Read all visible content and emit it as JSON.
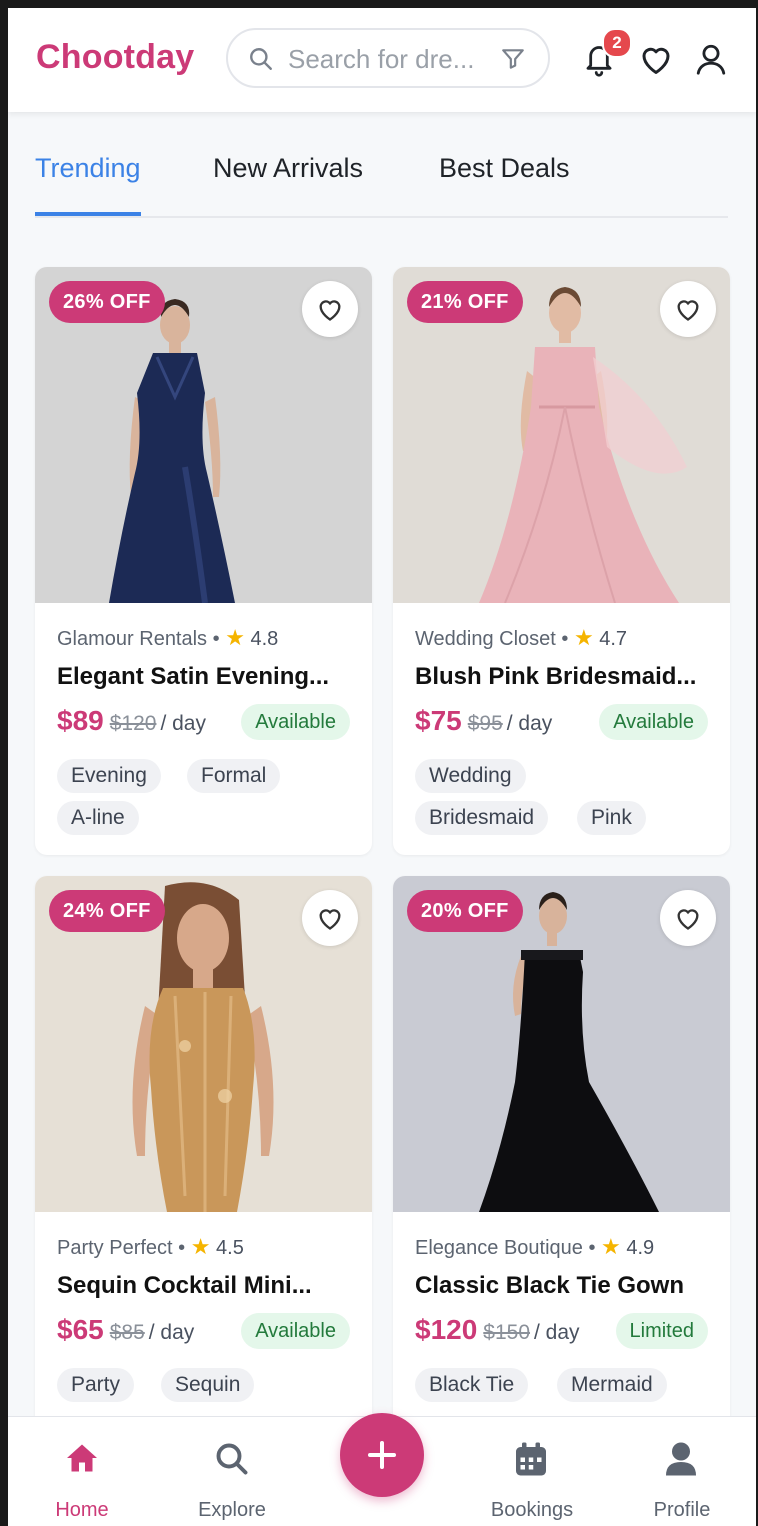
{
  "header": {
    "logo": "Chootday",
    "search_placeholder": "Search for dre...",
    "notification_count": "2"
  },
  "tabs": [
    {
      "label": "Trending",
      "active": true
    },
    {
      "label": "New Arrivals",
      "active": false
    },
    {
      "label": "Best Deals",
      "active": false
    }
  ],
  "products": [
    {
      "discount": "26% OFF",
      "shop": "Glamour Rentals",
      "rating": "4.8",
      "title": "Elegant Satin Evening...",
      "price": "$89",
      "old_price": "$120",
      "per": "/ day",
      "status": "Available",
      "tags": [
        "Evening",
        "Formal",
        "A-line"
      ],
      "dress_color": "#1c2a55"
    },
    {
      "discount": "21% OFF",
      "shop": "Wedding Closet",
      "rating": "4.7",
      "title": "Blush Pink Bridesmaid...",
      "price": "$75",
      "old_price": "$95",
      "per": "/ day",
      "status": "Available",
      "tags": [
        "Wedding",
        "Bridesmaid",
        "Pink"
      ],
      "dress_color": "#e9b3b9"
    },
    {
      "discount": "24% OFF",
      "shop": "Party Perfect",
      "rating": "4.5",
      "title": "Sequin Cocktail Mini...",
      "price": "$65",
      "old_price": "$85",
      "per": "/ day",
      "status": "Available",
      "tags": [
        "Party",
        "Sequin"
      ],
      "dress_color": "#c9975a"
    },
    {
      "discount": "20% OFF",
      "shop": "Elegance Boutique",
      "rating": "4.9",
      "title": "Classic Black Tie Gown",
      "price": "$120",
      "old_price": "$150",
      "per": "/ day",
      "status": "Limited",
      "tags": [
        "Black Tie",
        "Mermaid"
      ],
      "dress_color": "#0d0d10"
    }
  ],
  "bottom_nav": [
    {
      "label": "Home",
      "icon": "home-icon",
      "active": true
    },
    {
      "label": "Explore",
      "icon": "search-icon",
      "active": false
    },
    {
      "label": "Bookings",
      "icon": "calendar-icon",
      "active": false
    },
    {
      "label": "Profile",
      "icon": "person-icon",
      "active": false
    }
  ],
  "colors": {
    "brand": "#cc3a77",
    "tab_active": "#3b82e6",
    "badge": "#e5484d",
    "available_bg": "#e4f7ea",
    "available_text": "#237a3c"
  }
}
